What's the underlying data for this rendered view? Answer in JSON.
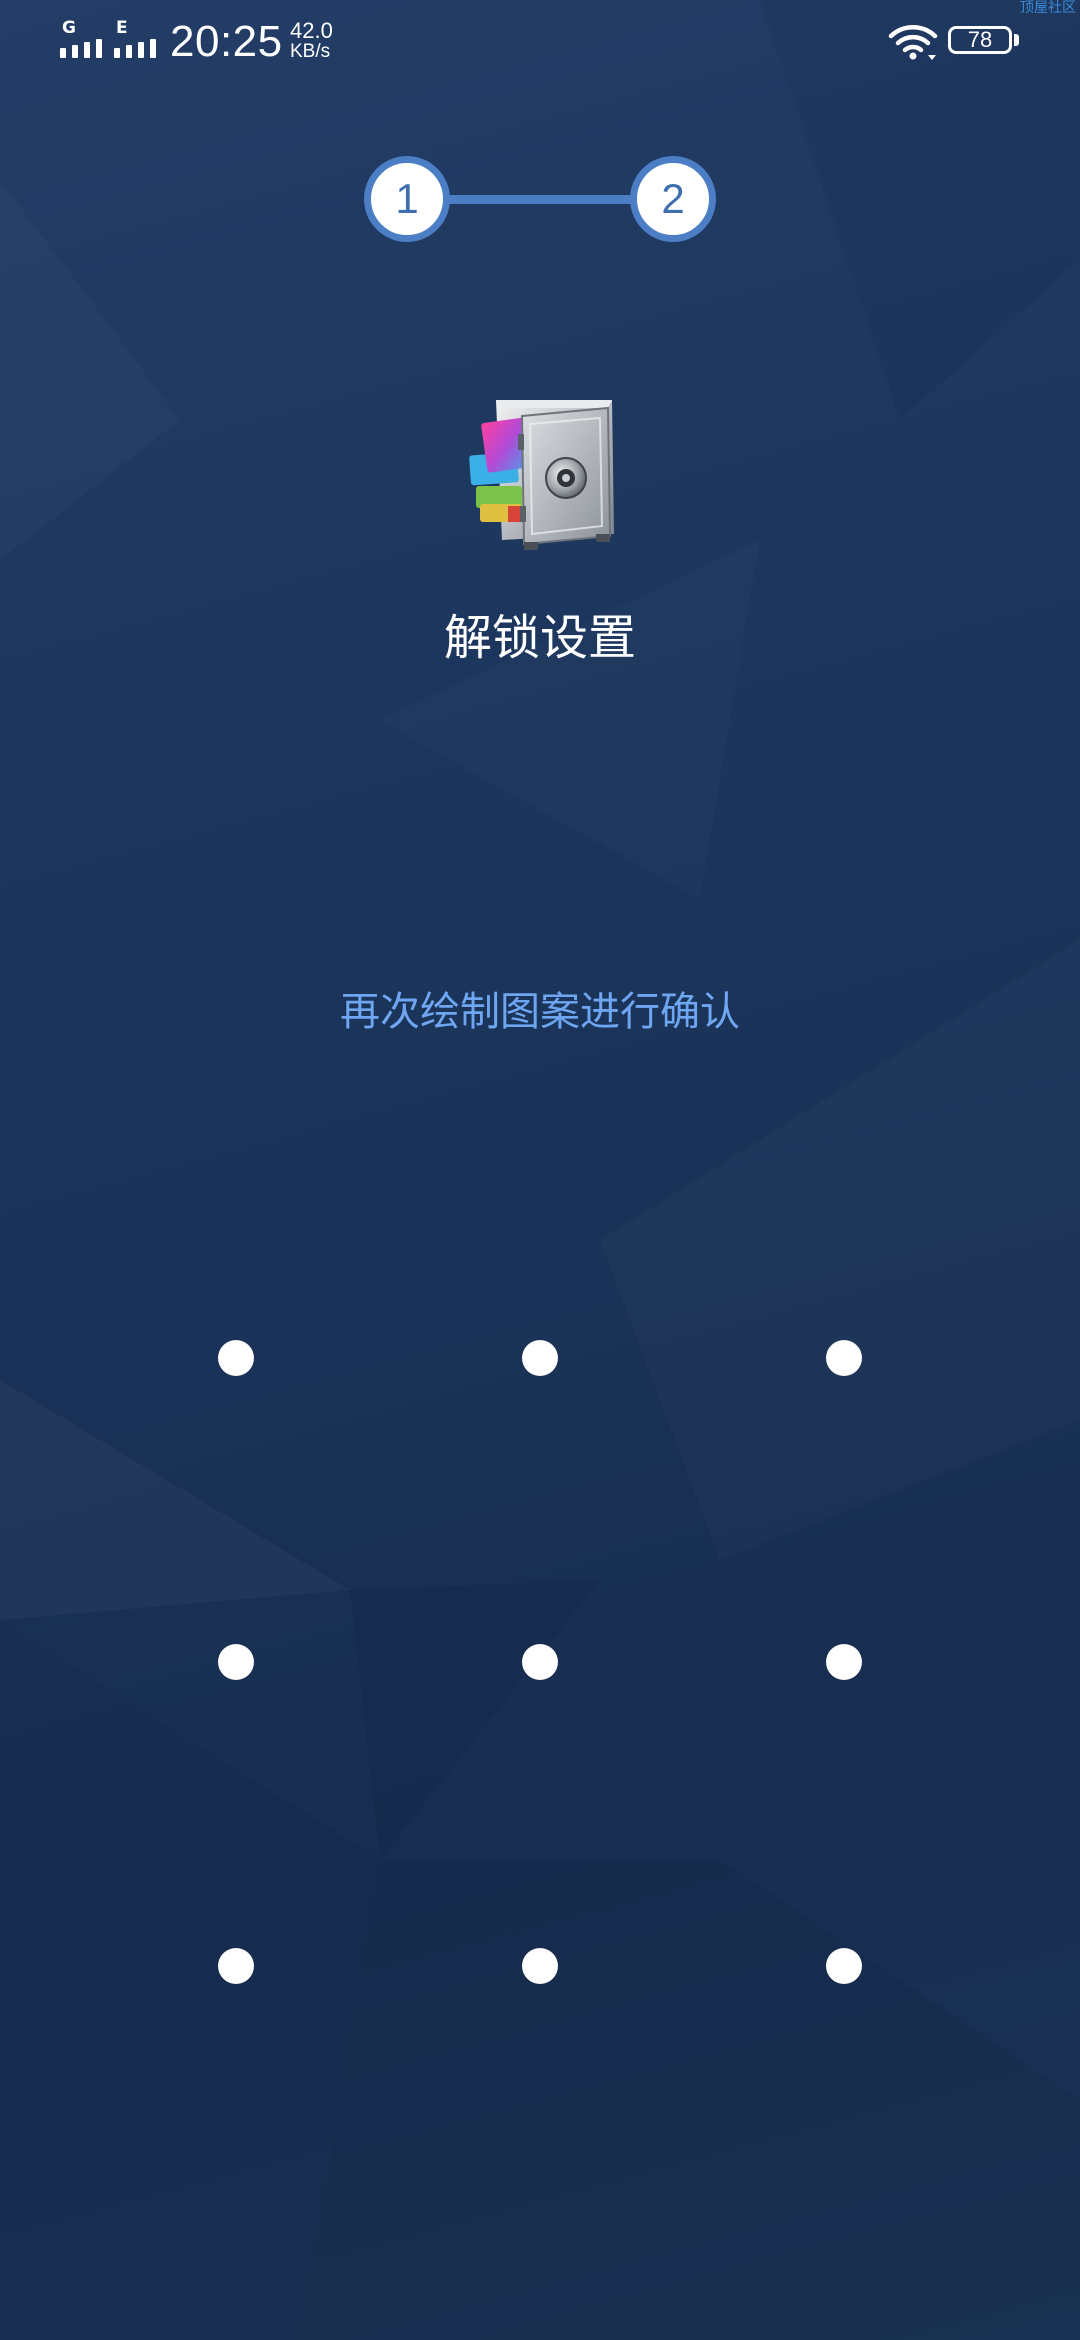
{
  "status_bar": {
    "network_1": "G",
    "network_2": "E",
    "time": "20:25",
    "speed_value": "42.0",
    "speed_unit": "KB/s",
    "battery_level": "78",
    "watermark": "顶屋社区"
  },
  "steps": {
    "step_1": "1",
    "step_2": "2",
    "current_step": 2
  },
  "app": {
    "logo_icon": "safe-vault-icon",
    "title": "解锁设置"
  },
  "pattern": {
    "instruction": "再次绘制图案进行确认",
    "grid_size": 3
  },
  "colors": {
    "background": "#1c355c",
    "accent": "#4b7ec4",
    "instruction_text": "#6ea6f2",
    "dot": "#ffffff"
  }
}
